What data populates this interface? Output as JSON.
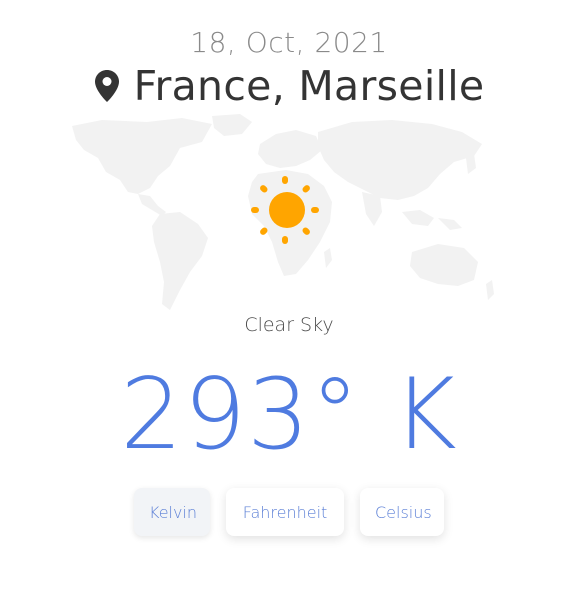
{
  "header": {
    "date": "18, Oct, 2021",
    "location": "France, Marseille"
  },
  "weather": {
    "condition": "Clear Sky",
    "temperature": "293° K",
    "icon": "sun-icon"
  },
  "units": {
    "kelvin": "Kelvin",
    "fahrenheit": "Fahrenheit",
    "celsius": "Celsius",
    "selected": "Kelvin"
  },
  "colors": {
    "accent": "#4f7be0",
    "sun": "#ffa500",
    "map": "#f2f2f2",
    "text_dark": "#343434",
    "text_muted": "#8a8a8a"
  }
}
